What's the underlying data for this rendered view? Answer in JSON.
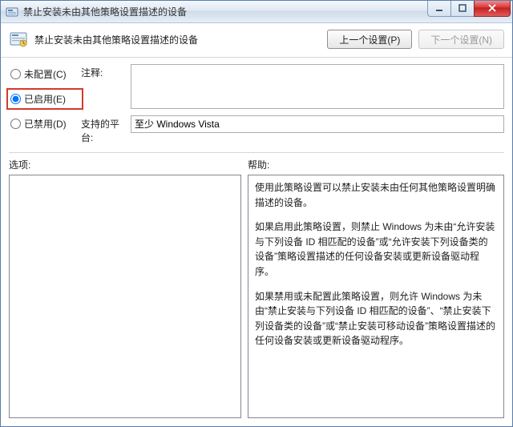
{
  "window": {
    "title": "禁止安装未由其他策略设置描述的设备"
  },
  "header": {
    "page_title": "禁止安装未由其他策略设置描述的设备",
    "prev_btn": "上一个设置(P)",
    "next_btn": "下一个设置(N)"
  },
  "config": {
    "radios": {
      "not_configured": "未配置(C)",
      "enabled": "已启用(E)",
      "disabled": "已禁用(D)",
      "selected": "enabled"
    },
    "comment_label": "注释:",
    "comment_value": "",
    "platform_label": "支持的平台:",
    "platform_value": "至少 Windows Vista"
  },
  "panes": {
    "options_label": "选项:",
    "help_label": "帮助:",
    "help_paragraphs": [
      "使用此策略设置可以禁止安装未由任何其他策略设置明确描述的设备。",
      "如果启用此策略设置，则禁止 Windows 为未由“允许安装与下列设备 ID 相匹配的设备”或“允许安装下列设备类的设备”策略设置描述的任何设备安装或更新设备驱动程序。",
      "如果禁用或未配置此策略设置，则允许 Windows 为未由“禁止安装与下列设备 ID 相匹配的设备”、“禁止安装下列设备类的设备”或“禁止安装可移动设备”策略设置描述的任何设备安装或更新设备驱动程序。"
    ]
  }
}
